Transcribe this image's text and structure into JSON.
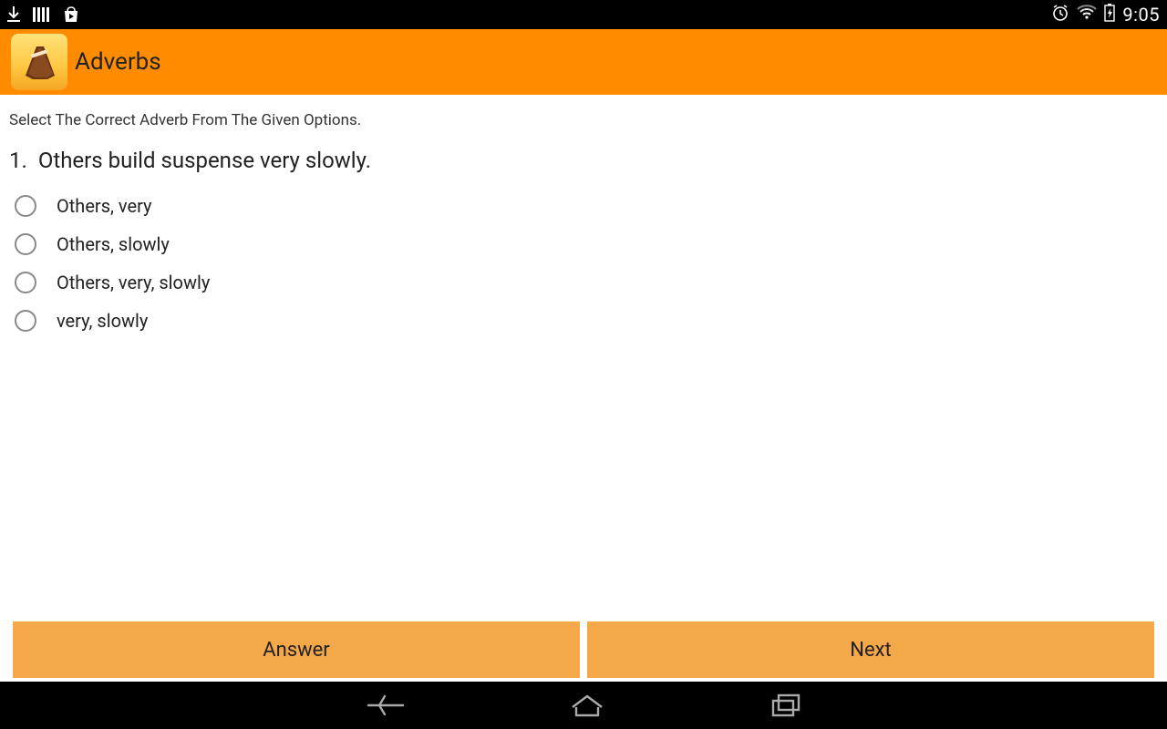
{
  "status": {
    "time": "9:05"
  },
  "app": {
    "title": "Adverbs"
  },
  "quiz": {
    "instruction": "Select The Correct Adverb From The Given Options.",
    "number": "1.",
    "question": "Others build suspense very slowly.",
    "options": [
      "Others, very",
      "Others, slowly",
      "Others, very, slowly",
      "very, slowly"
    ]
  },
  "buttons": {
    "answer": "Answer",
    "next": "Next"
  }
}
